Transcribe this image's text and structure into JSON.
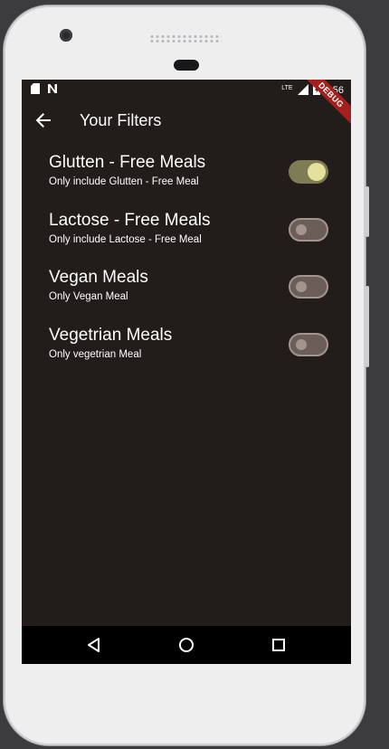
{
  "status_bar": {
    "time": "5:56",
    "network_label": "LTE",
    "icons": [
      "sd-card-icon",
      "notification-n-icon",
      "signal-icon",
      "battery-charging-icon"
    ]
  },
  "debug_banner": "DEBUG",
  "app_bar": {
    "title": "Your Filters",
    "back_icon": "arrow-back-icon"
  },
  "filters": [
    {
      "title": "Glutten - Free Meals",
      "subtitle": "Only include Glutten - Free Meal",
      "enabled": true
    },
    {
      "title": "Lactose - Free Meals",
      "subtitle": "Only include Lactose - Free Meal",
      "enabled": false
    },
    {
      "title": "Vegan Meals",
      "subtitle": "Only Vegan Meal",
      "enabled": false
    },
    {
      "title": "Vegetrian Meals",
      "subtitle": "Only vegetrian Meal",
      "enabled": false
    }
  ],
  "nav_bar": {
    "buttons": [
      "back-triangle-icon",
      "home-circle-icon",
      "recents-square-icon"
    ]
  },
  "colors": {
    "screen_background": "#221c1a",
    "switch_on_track": "#7f7b55",
    "switch_on_thumb": "#e5e19c",
    "switch_off_track": "#6b5e58",
    "switch_off_thumb": "#a39490",
    "debug_ribbon": "#a5201c"
  }
}
